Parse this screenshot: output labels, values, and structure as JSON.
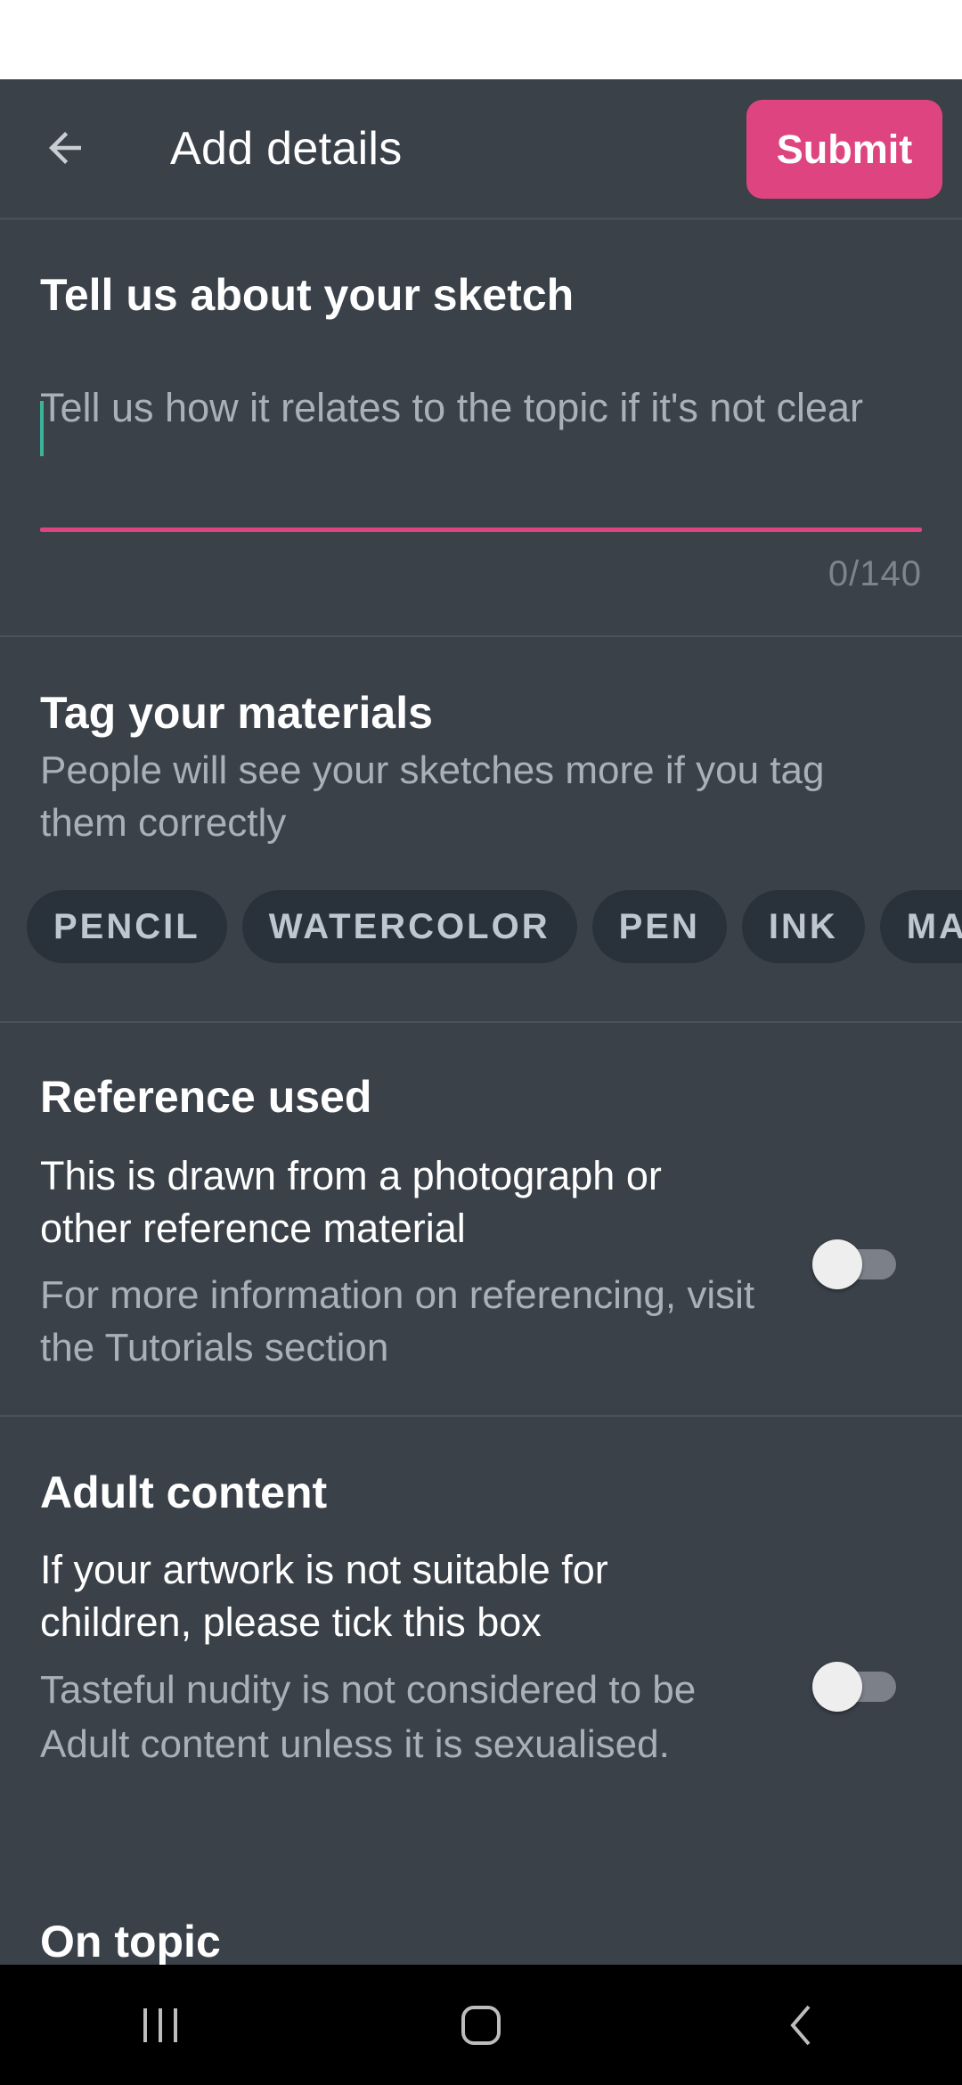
{
  "appbar": {
    "title": "Add details",
    "submit_label": "Submit",
    "back_icon": "arrow-left-icon"
  },
  "description": {
    "heading": "Tell us about your sketch",
    "placeholder": "Tell us how it relates to the topic if it's not clear",
    "value": "",
    "counter": "0/140",
    "accent_color": "#de4580"
  },
  "materials": {
    "heading": "Tag your materials",
    "subtitle": "People will see your sketches more if you tag them correctly",
    "chips": [
      "PENCIL",
      "WATERCOLOR",
      "PEN",
      "INK",
      "MARK"
    ]
  },
  "reference": {
    "heading": "Reference used",
    "text": "This is drawn from a photograph or other reference material",
    "note": "For more information on referencing, visit the Tutorials section",
    "enabled": false
  },
  "adult": {
    "heading": "Adult content",
    "text": "If your artwork is not suitable for children, please tick this box",
    "note": "Tasteful nudity is not considered to be Adult content unless it is sexualised.",
    "enabled": false
  },
  "on_topic": {
    "heading": "On topic"
  },
  "navbar": {
    "recents_icon": "recent-apps-icon",
    "home_icon": "home-icon",
    "back_icon": "nav-back-icon"
  }
}
